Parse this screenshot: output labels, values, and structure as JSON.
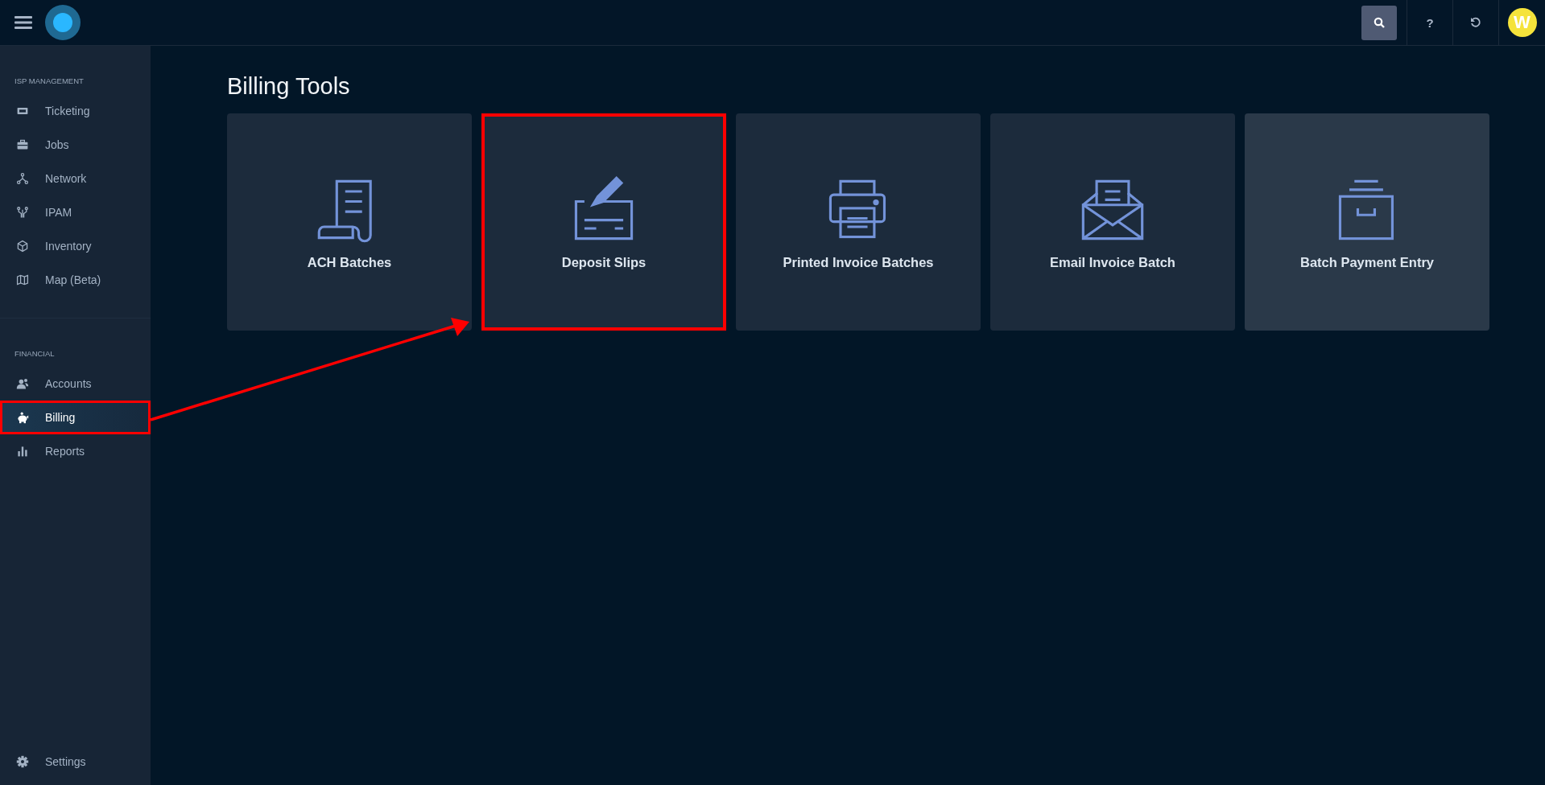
{
  "top_bar": {
    "avatar_letter": "W",
    "help": "?"
  },
  "sidebar": {
    "sections": [
      {
        "title": "ISP MANAGEMENT",
        "items": [
          {
            "label": "Ticketing",
            "selected": false,
            "annotated": false
          },
          {
            "label": "Jobs",
            "selected": false,
            "annotated": false
          },
          {
            "label": "Network",
            "selected": false,
            "annotated": false
          },
          {
            "label": "IPAM",
            "selected": false,
            "annotated": false
          },
          {
            "label": "Inventory",
            "selected": false,
            "annotated": false
          },
          {
            "label": "Map (Beta)",
            "selected": false,
            "annotated": false
          }
        ]
      },
      {
        "title": "FINANCIAL",
        "items": [
          {
            "label": "Accounts",
            "selected": false,
            "annotated": false
          },
          {
            "label": "Billing",
            "selected": true,
            "annotated": true
          },
          {
            "label": "Reports",
            "selected": false,
            "annotated": false
          }
        ]
      }
    ],
    "footer": {
      "label": "Settings"
    }
  },
  "page_title": "Billing Tools",
  "cards": [
    {
      "label": "ACH Batches",
      "hovered": false,
      "annotated": false
    },
    {
      "label": "Deposit Slips",
      "hovered": false,
      "annotated": true
    },
    {
      "label": "Printed Invoice Batches",
      "hovered": false,
      "annotated": false
    },
    {
      "label": "Email Invoice Batch",
      "hovered": false,
      "annotated": false
    },
    {
      "label": "Batch Payment Entry",
      "hovered": true,
      "annotated": false
    }
  ]
}
